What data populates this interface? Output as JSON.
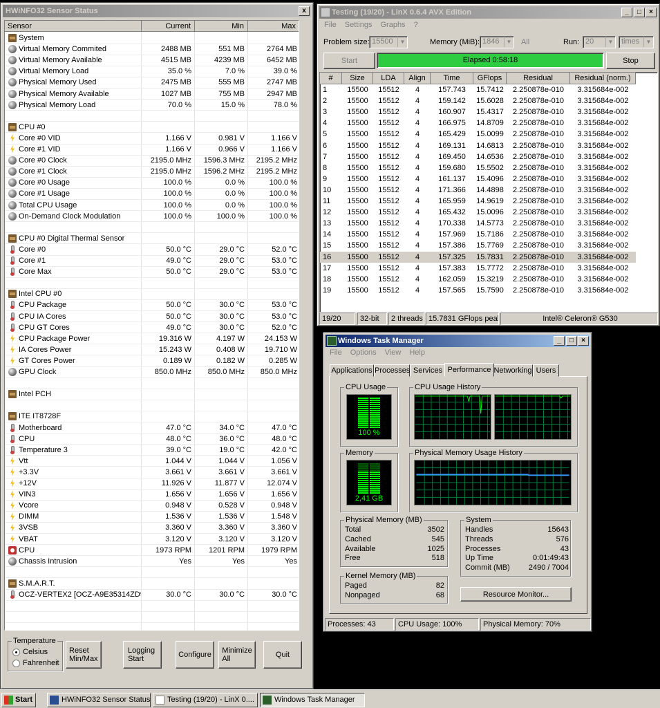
{
  "hwinfo": {
    "title": "HWiNFO32 Sensor Status",
    "close_glyph": "x",
    "columns": [
      "Sensor",
      "Current",
      "Min",
      "Max"
    ],
    "rows": [
      {
        "type": "group",
        "icon": "chip",
        "name": "System"
      },
      {
        "icon": "dot",
        "name": "Virtual Memory Commited",
        "cur": "2488 MB",
        "min": "551 MB",
        "max": "2764 MB"
      },
      {
        "icon": "dot",
        "name": "Virtual Memory Available",
        "cur": "4515 MB",
        "min": "4239 MB",
        "max": "6452 MB"
      },
      {
        "icon": "dot",
        "name": "Virtual Memory Load",
        "cur": "35.0 %",
        "min": "7.0 %",
        "max": "39.0 %"
      },
      {
        "icon": "dot",
        "name": "Physical Memory Used",
        "cur": "2475 MB",
        "min": "555 MB",
        "max": "2747 MB"
      },
      {
        "icon": "dot",
        "name": "Physical Memory Available",
        "cur": "1027 MB",
        "min": "755 MB",
        "max": "2947 MB"
      },
      {
        "icon": "dot",
        "name": "Physical Memory Load",
        "cur": "70.0 %",
        "min": "15.0 %",
        "max": "78.0 %"
      },
      {
        "type": "blank"
      },
      {
        "type": "group",
        "icon": "chip",
        "name": "CPU #0"
      },
      {
        "icon": "bolt",
        "name": "Core #0 VID",
        "cur": "1.166 V",
        "min": "0.981 V",
        "max": "1.166 V"
      },
      {
        "icon": "bolt",
        "name": "Core #1 VID",
        "cur": "1.166 V",
        "min": "0.966 V",
        "max": "1.166 V"
      },
      {
        "icon": "dot",
        "name": "Core #0 Clock",
        "cur": "2195.0 MHz",
        "min": "1596.3 MHz",
        "max": "2195.2 MHz"
      },
      {
        "icon": "dot",
        "name": "Core #1 Clock",
        "cur": "2195.0 MHz",
        "min": "1596.2 MHz",
        "max": "2195.2 MHz"
      },
      {
        "icon": "dot",
        "name": "Core #0 Usage",
        "cur": "100.0 %",
        "min": "0.0 %",
        "max": "100.0 %"
      },
      {
        "icon": "dot",
        "name": "Core #1 Usage",
        "cur": "100.0 %",
        "min": "0.0 %",
        "max": "100.0 %"
      },
      {
        "icon": "dot",
        "name": "Total CPU Usage",
        "cur": "100.0 %",
        "min": "0.0 %",
        "max": "100.0 %"
      },
      {
        "icon": "dot",
        "name": "On-Demand Clock Modulation",
        "cur": "100.0 %",
        "min": "100.0 %",
        "max": "100.0 %"
      },
      {
        "type": "blank"
      },
      {
        "type": "group",
        "icon": "chip",
        "name": "CPU #0 Digital Thermal Sensor"
      },
      {
        "icon": "therm",
        "name": "Core #0",
        "cur": "50.0 °C",
        "min": "29.0 °C",
        "max": "52.0 °C"
      },
      {
        "icon": "therm",
        "name": "Core #1",
        "cur": "49.0 °C",
        "min": "29.0 °C",
        "max": "53.0 °C"
      },
      {
        "icon": "therm",
        "name": "Core Max",
        "cur": "50.0 °C",
        "min": "29.0 °C",
        "max": "53.0 °C"
      },
      {
        "type": "blank"
      },
      {
        "type": "group",
        "icon": "chip",
        "name": "Intel CPU #0"
      },
      {
        "icon": "therm",
        "name": "CPU Package",
        "cur": "50.0 °C",
        "min": "30.0 °C",
        "max": "53.0 °C"
      },
      {
        "icon": "therm",
        "name": "CPU IA Cores",
        "cur": "50.0 °C",
        "min": "30.0 °C",
        "max": "53.0 °C"
      },
      {
        "icon": "therm",
        "name": "CPU GT Cores",
        "cur": "49.0 °C",
        "min": "30.0 °C",
        "max": "52.0 °C"
      },
      {
        "icon": "bolt",
        "name": "CPU Package Power",
        "cur": "19.316 W",
        "min": "4.197 W",
        "max": "24.153 W"
      },
      {
        "icon": "bolt",
        "name": "IA Cores Power",
        "cur": "15.243 W",
        "min": "0.408 W",
        "max": "19.710 W"
      },
      {
        "icon": "bolt",
        "name": "GT Cores Power",
        "cur": "0.189 W",
        "min": "0.182 W",
        "max": "0.285 W"
      },
      {
        "icon": "dot",
        "name": "GPU Clock",
        "cur": "850.0 MHz",
        "min": "850.0 MHz",
        "max": "850.0 MHz"
      },
      {
        "type": "blank"
      },
      {
        "type": "group",
        "icon": "chip",
        "name": "Intel PCH"
      },
      {
        "type": "blank"
      },
      {
        "type": "group",
        "icon": "chip",
        "name": "ITE IT8728F"
      },
      {
        "icon": "therm",
        "name": "Motherboard",
        "cur": "47.0 °C",
        "min": "34.0 °C",
        "max": "47.0 °C"
      },
      {
        "icon": "therm",
        "name": "CPU",
        "cur": "48.0 °C",
        "min": "36.0 °C",
        "max": "48.0 °C"
      },
      {
        "icon": "therm",
        "name": "Temperature 3",
        "cur": "39.0 °C",
        "min": "19.0 °C",
        "max": "42.0 °C"
      },
      {
        "icon": "bolt",
        "name": "Vtt",
        "cur": "1.044 V",
        "min": "1.044 V",
        "max": "1.056 V"
      },
      {
        "icon": "bolt",
        "name": "+3.3V",
        "cur": "3.661 V",
        "min": "3.661 V",
        "max": "3.661 V"
      },
      {
        "icon": "bolt",
        "name": "+12V",
        "cur": "11.926 V",
        "min": "11.877 V",
        "max": "12.074 V"
      },
      {
        "icon": "bolt",
        "name": "VIN3",
        "cur": "1.656 V",
        "min": "1.656 V",
        "max": "1.656 V"
      },
      {
        "icon": "bolt",
        "name": "Vcore",
        "cur": "0.948 V",
        "min": "0.528 V",
        "max": "0.948 V"
      },
      {
        "icon": "bolt",
        "name": "DIMM",
        "cur": "1.536 V",
        "min": "1.536 V",
        "max": "1.548 V"
      },
      {
        "icon": "bolt",
        "name": "3VSB",
        "cur": "3.360 V",
        "min": "3.360 V",
        "max": "3.360 V"
      },
      {
        "icon": "bolt",
        "name": "VBAT",
        "cur": "3.120 V",
        "min": "3.120 V",
        "max": "3.120 V"
      },
      {
        "icon": "fan",
        "name": "CPU",
        "cur": "1973 RPM",
        "min": "1201 RPM",
        "max": "1979 RPM"
      },
      {
        "icon": "dot",
        "name": "Chassis Intrusion",
        "cur": "Yes",
        "min": "Yes",
        "max": "Yes"
      },
      {
        "type": "blank"
      },
      {
        "type": "group",
        "icon": "chip",
        "name": "S.M.A.R.T."
      },
      {
        "icon": "therm",
        "name": "OCZ-VERTEX2 [OCZ-A9E35314ZD9...",
        "cur": "30.0 °C",
        "min": "30.0 °C",
        "max": "30.0 °C"
      }
    ],
    "temperature_group": "Temperature",
    "celsius": "Celsius",
    "fahrenheit": "Fahrenheit",
    "unit_selected": "Celsius",
    "buttons": {
      "reset": "Reset Min/Max",
      "logging": "Logging Start",
      "configure": "Configure",
      "minimize": "Minimize All",
      "quit": "Quit"
    }
  },
  "linx": {
    "title": "Testing (19/20) - LinX 0.6.4 AVX Edition",
    "menu": [
      "File",
      "Settings",
      "Graphs",
      "?"
    ],
    "problem_size_label": "Problem size:",
    "problem_size": "15500",
    "memory_label": "Memory (MiB):",
    "memory": "1846",
    "all_label": "All",
    "run_label": "Run:",
    "run_value": "20",
    "run_unit": "times",
    "start": "Start",
    "stop": "Stop",
    "elapsed": "Elapsed 0:58:18",
    "progress": 1.0,
    "progress_color": "#2ecc40",
    "columns": [
      "#",
      "Size",
      "LDA",
      "Align",
      "Time",
      "GFlops",
      "Residual",
      "Residual (norm.)"
    ],
    "rows": [
      [
        "1",
        "15500",
        "15512",
        "4",
        "157.743",
        "15.7412",
        "2.250878e-010",
        "3.315684e-002"
      ],
      [
        "2",
        "15500",
        "15512",
        "4",
        "159.142",
        "15.6028",
        "2.250878e-010",
        "3.315684e-002"
      ],
      [
        "3",
        "15500",
        "15512",
        "4",
        "160.907",
        "15.4317",
        "2.250878e-010",
        "3.315684e-002"
      ],
      [
        "4",
        "15500",
        "15512",
        "4",
        "166.975",
        "14.8709",
        "2.250878e-010",
        "3.315684e-002"
      ],
      [
        "5",
        "15500",
        "15512",
        "4",
        "165.429",
        "15.0099",
        "2.250878e-010",
        "3.315684e-002"
      ],
      [
        "6",
        "15500",
        "15512",
        "4",
        "169.131",
        "14.6813",
        "2.250878e-010",
        "3.315684e-002"
      ],
      [
        "7",
        "15500",
        "15512",
        "4",
        "169.450",
        "14.6536",
        "2.250878e-010",
        "3.315684e-002"
      ],
      [
        "8",
        "15500",
        "15512",
        "4",
        "159.680",
        "15.5502",
        "2.250878e-010",
        "3.315684e-002"
      ],
      [
        "9",
        "15500",
        "15512",
        "4",
        "161.137",
        "15.4096",
        "2.250878e-010",
        "3.315684e-002"
      ],
      [
        "10",
        "15500",
        "15512",
        "4",
        "171.366",
        "14.4898",
        "2.250878e-010",
        "3.315684e-002"
      ],
      [
        "11",
        "15500",
        "15512",
        "4",
        "165.959",
        "14.9619",
        "2.250878e-010",
        "3.315684e-002"
      ],
      [
        "12",
        "15500",
        "15512",
        "4",
        "165.432",
        "15.0096",
        "2.250878e-010",
        "3.315684e-002"
      ],
      [
        "13",
        "15500",
        "15512",
        "4",
        "170.338",
        "14.5773",
        "2.250878e-010",
        "3.315684e-002"
      ],
      [
        "14",
        "15500",
        "15512",
        "4",
        "157.969",
        "15.7186",
        "2.250878e-010",
        "3.315684e-002"
      ],
      [
        "15",
        "15500",
        "15512",
        "4",
        "157.386",
        "15.7769",
        "2.250878e-010",
        "3.315684e-002"
      ],
      [
        "16",
        "15500",
        "15512",
        "4",
        "157.325",
        "15.7831",
        "2.250878e-010",
        "3.315684e-002"
      ],
      [
        "17",
        "15500",
        "15512",
        "4",
        "157.383",
        "15.7772",
        "2.250878e-010",
        "3.315684e-002"
      ],
      [
        "18",
        "15500",
        "15512",
        "4",
        "162.059",
        "15.3219",
        "2.250878e-010",
        "3.315684e-002"
      ],
      [
        "19",
        "15500",
        "15512",
        "4",
        "157.565",
        "15.7590",
        "2.250878e-010",
        "3.315684e-002"
      ]
    ],
    "selected_row": "16",
    "status": [
      "19/20",
      "32-bit",
      "2 threads",
      "15.7831 GFlops peak",
      "Intel® Celeron® G530"
    ]
  },
  "taskmgr": {
    "title": "Windows Task Manager",
    "menu": [
      "File",
      "Options",
      "View",
      "Help"
    ],
    "tabs": [
      "Applications",
      "Processes",
      "Services",
      "Performance",
      "Networking",
      "Users"
    ],
    "active_tab": "Performance",
    "cpu_usage_label": "CPU Usage",
    "cpu_usage_value": "100 %",
    "cpu_usage_fraction": 1.0,
    "cpu_history_label": "CPU Usage History",
    "memory_label": "Memory",
    "memory_value": "2,41 GB",
    "memory_fraction": 0.7,
    "mem_history_label": "Physical Memory Usage History",
    "physical_memory": {
      "label": "Physical Memory (MB)",
      "items": [
        [
          "Total",
          "3502"
        ],
        [
          "Cached",
          "545"
        ],
        [
          "Available",
          "1025"
        ],
        [
          "Free",
          "518"
        ]
      ]
    },
    "kernel_memory": {
      "label": "Kernel Memory (MB)",
      "items": [
        [
          "Paged",
          "82"
        ],
        [
          "Nonpaged",
          "68"
        ]
      ]
    },
    "system": {
      "label": "System",
      "items": [
        [
          "Handles",
          "15643"
        ],
        [
          "Threads",
          "576"
        ],
        [
          "Processes",
          "43"
        ],
        [
          "Up Time",
          "0:01:49:43"
        ],
        [
          "Commit (MB)",
          "2490 / 7004"
        ]
      ]
    },
    "resource_monitor": "Resource Monitor...",
    "status": [
      "Processes: 43",
      "CPU Usage: 100%",
      "Physical Memory: 70%"
    ],
    "graph_color": "#00ff00",
    "mem_line_color": "#3399ff"
  },
  "taskbar": {
    "start": "Start",
    "items": [
      "HWiNFO32 Sensor Status",
      "Testing (19/20) - LinX 0....",
      "Windows Task Manager"
    ]
  }
}
